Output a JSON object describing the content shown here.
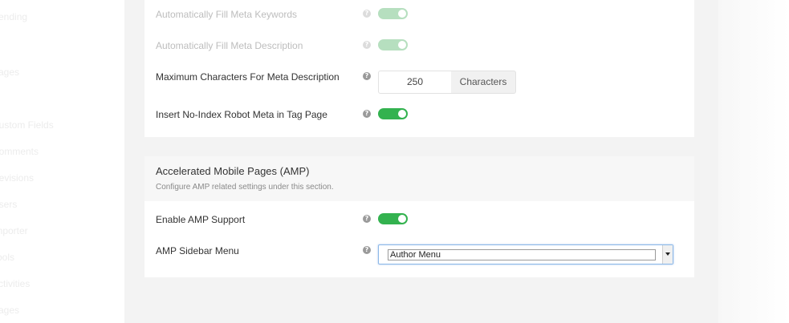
{
  "sidebar": {
    "items": [
      "Pending",
      "Pages",
      "Custom Fields",
      "Comments",
      "Revisions",
      "Users",
      "Importer",
      "Tools",
      "Activities",
      "Pages"
    ]
  },
  "seo": {
    "fill_keywords_label": "Automatically Fill Meta Keywords",
    "fill_description_label": "Automatically Fill Meta Description",
    "max_chars_label": "Maximum Characters For Meta Description",
    "max_chars_value": "250",
    "max_chars_unit": "Characters",
    "noindex_label": "Insert No-Index Robot Meta in Tag Page",
    "help_glyph": "?"
  },
  "amp": {
    "title": "Accelerated Mobile Pages (AMP)",
    "description": "Configure AMP related settings under this section.",
    "enable_label": "Enable AMP Support",
    "sidebar_menu_label": "AMP Sidebar Menu",
    "sidebar_menu_value": "Author Menu"
  },
  "colors": {
    "toggle_on": "#33b24f",
    "focus_border": "#8bb8e8"
  },
  "icons": {
    "help": "question-circle-icon",
    "dropdown": "caret-down-icon"
  }
}
